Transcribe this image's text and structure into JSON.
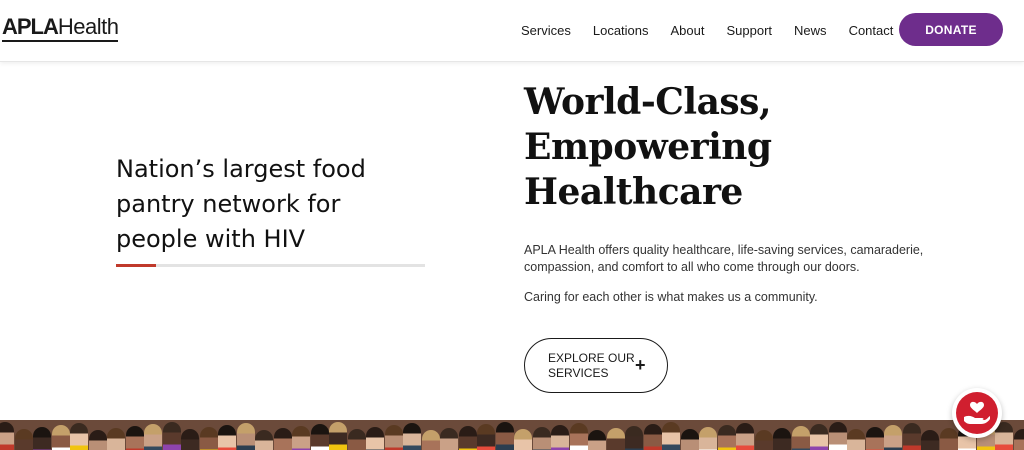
{
  "header": {
    "logo_bold": "APLA",
    "logo_light": "Health",
    "nav": [
      "Services",
      "Locations",
      "About",
      "Support",
      "News",
      "Contact"
    ],
    "donate_label": "DONATE"
  },
  "slider": {
    "text": "Nation’s largest food pantry network for people with HIV",
    "progress": 0.13
  },
  "hero": {
    "title": "World-Class, Empowering Healthcare",
    "description": "APLA Health offers quality healthcare, life-saving services, camaraderie, compassion, and comfort to all who come through our doors.",
    "tagline": "Caring for each other is what makes us a community.",
    "cta_label": "EXPLORE OUR SERVICES",
    "cta_icon": "plus-icon"
  },
  "colors": {
    "brand_purple": "#6e2d8c",
    "accent_red": "#c0392b",
    "help_red": "#d01f2f"
  },
  "widgets": {
    "help_icon": "hand-heart-icon"
  }
}
